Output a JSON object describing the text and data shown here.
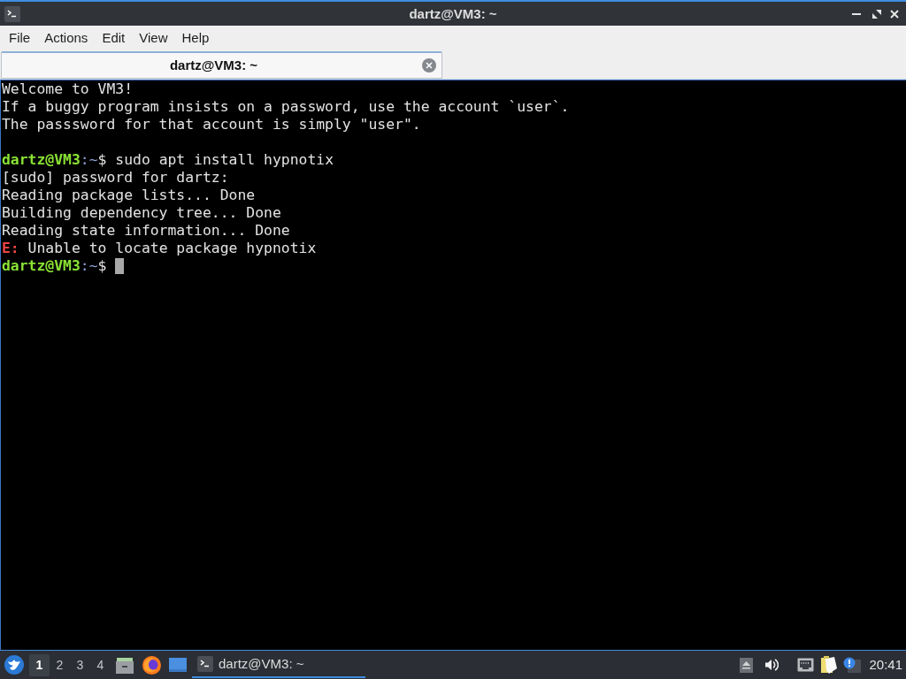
{
  "window": {
    "title": "dartz@VM3: ~"
  },
  "menu_bar": [
    "File",
    "Actions",
    "Edit",
    "View",
    "Help"
  ],
  "tabs": [
    {
      "label": "dartz@VM3: ~",
      "selected": true
    }
  ],
  "terminal": {
    "lines": [
      {
        "kind": "output",
        "text": "Welcome to VM3!"
      },
      {
        "kind": "output",
        "text": "If a buggy program insists on a password, use the account `user`."
      },
      {
        "kind": "output",
        "text": "The passsword for that account is simply \"user\"."
      },
      {
        "kind": "blank"
      },
      {
        "kind": "prompt",
        "user_host": "dartz@VM3",
        "separator": ":",
        "path": "~",
        "symbol": "$",
        "command": "sudo apt install hypnotix"
      },
      {
        "kind": "output",
        "text": "[sudo] password for dartz:"
      },
      {
        "kind": "output",
        "text": "Reading package lists... Done"
      },
      {
        "kind": "output",
        "text": "Building dependency tree... Done"
      },
      {
        "kind": "output",
        "text": "Reading state information... Done"
      },
      {
        "kind": "error",
        "label": "E:",
        "text": "Unable to locate package hypnotix"
      },
      {
        "kind": "prompt",
        "user_host": "dartz@VM3",
        "separator": ":",
        "path": "~",
        "symbol": "$",
        "cursor": true
      }
    ]
  },
  "taskbar": {
    "desktops": [
      {
        "label": "1",
        "selected": true
      },
      {
        "label": "2",
        "selected": false
      },
      {
        "label": "3",
        "selected": false
      },
      {
        "label": "4",
        "selected": false
      }
    ],
    "tasks": [
      {
        "label": "dartz@VM3: ~",
        "selected": true
      }
    ],
    "clock": "20:41"
  }
}
